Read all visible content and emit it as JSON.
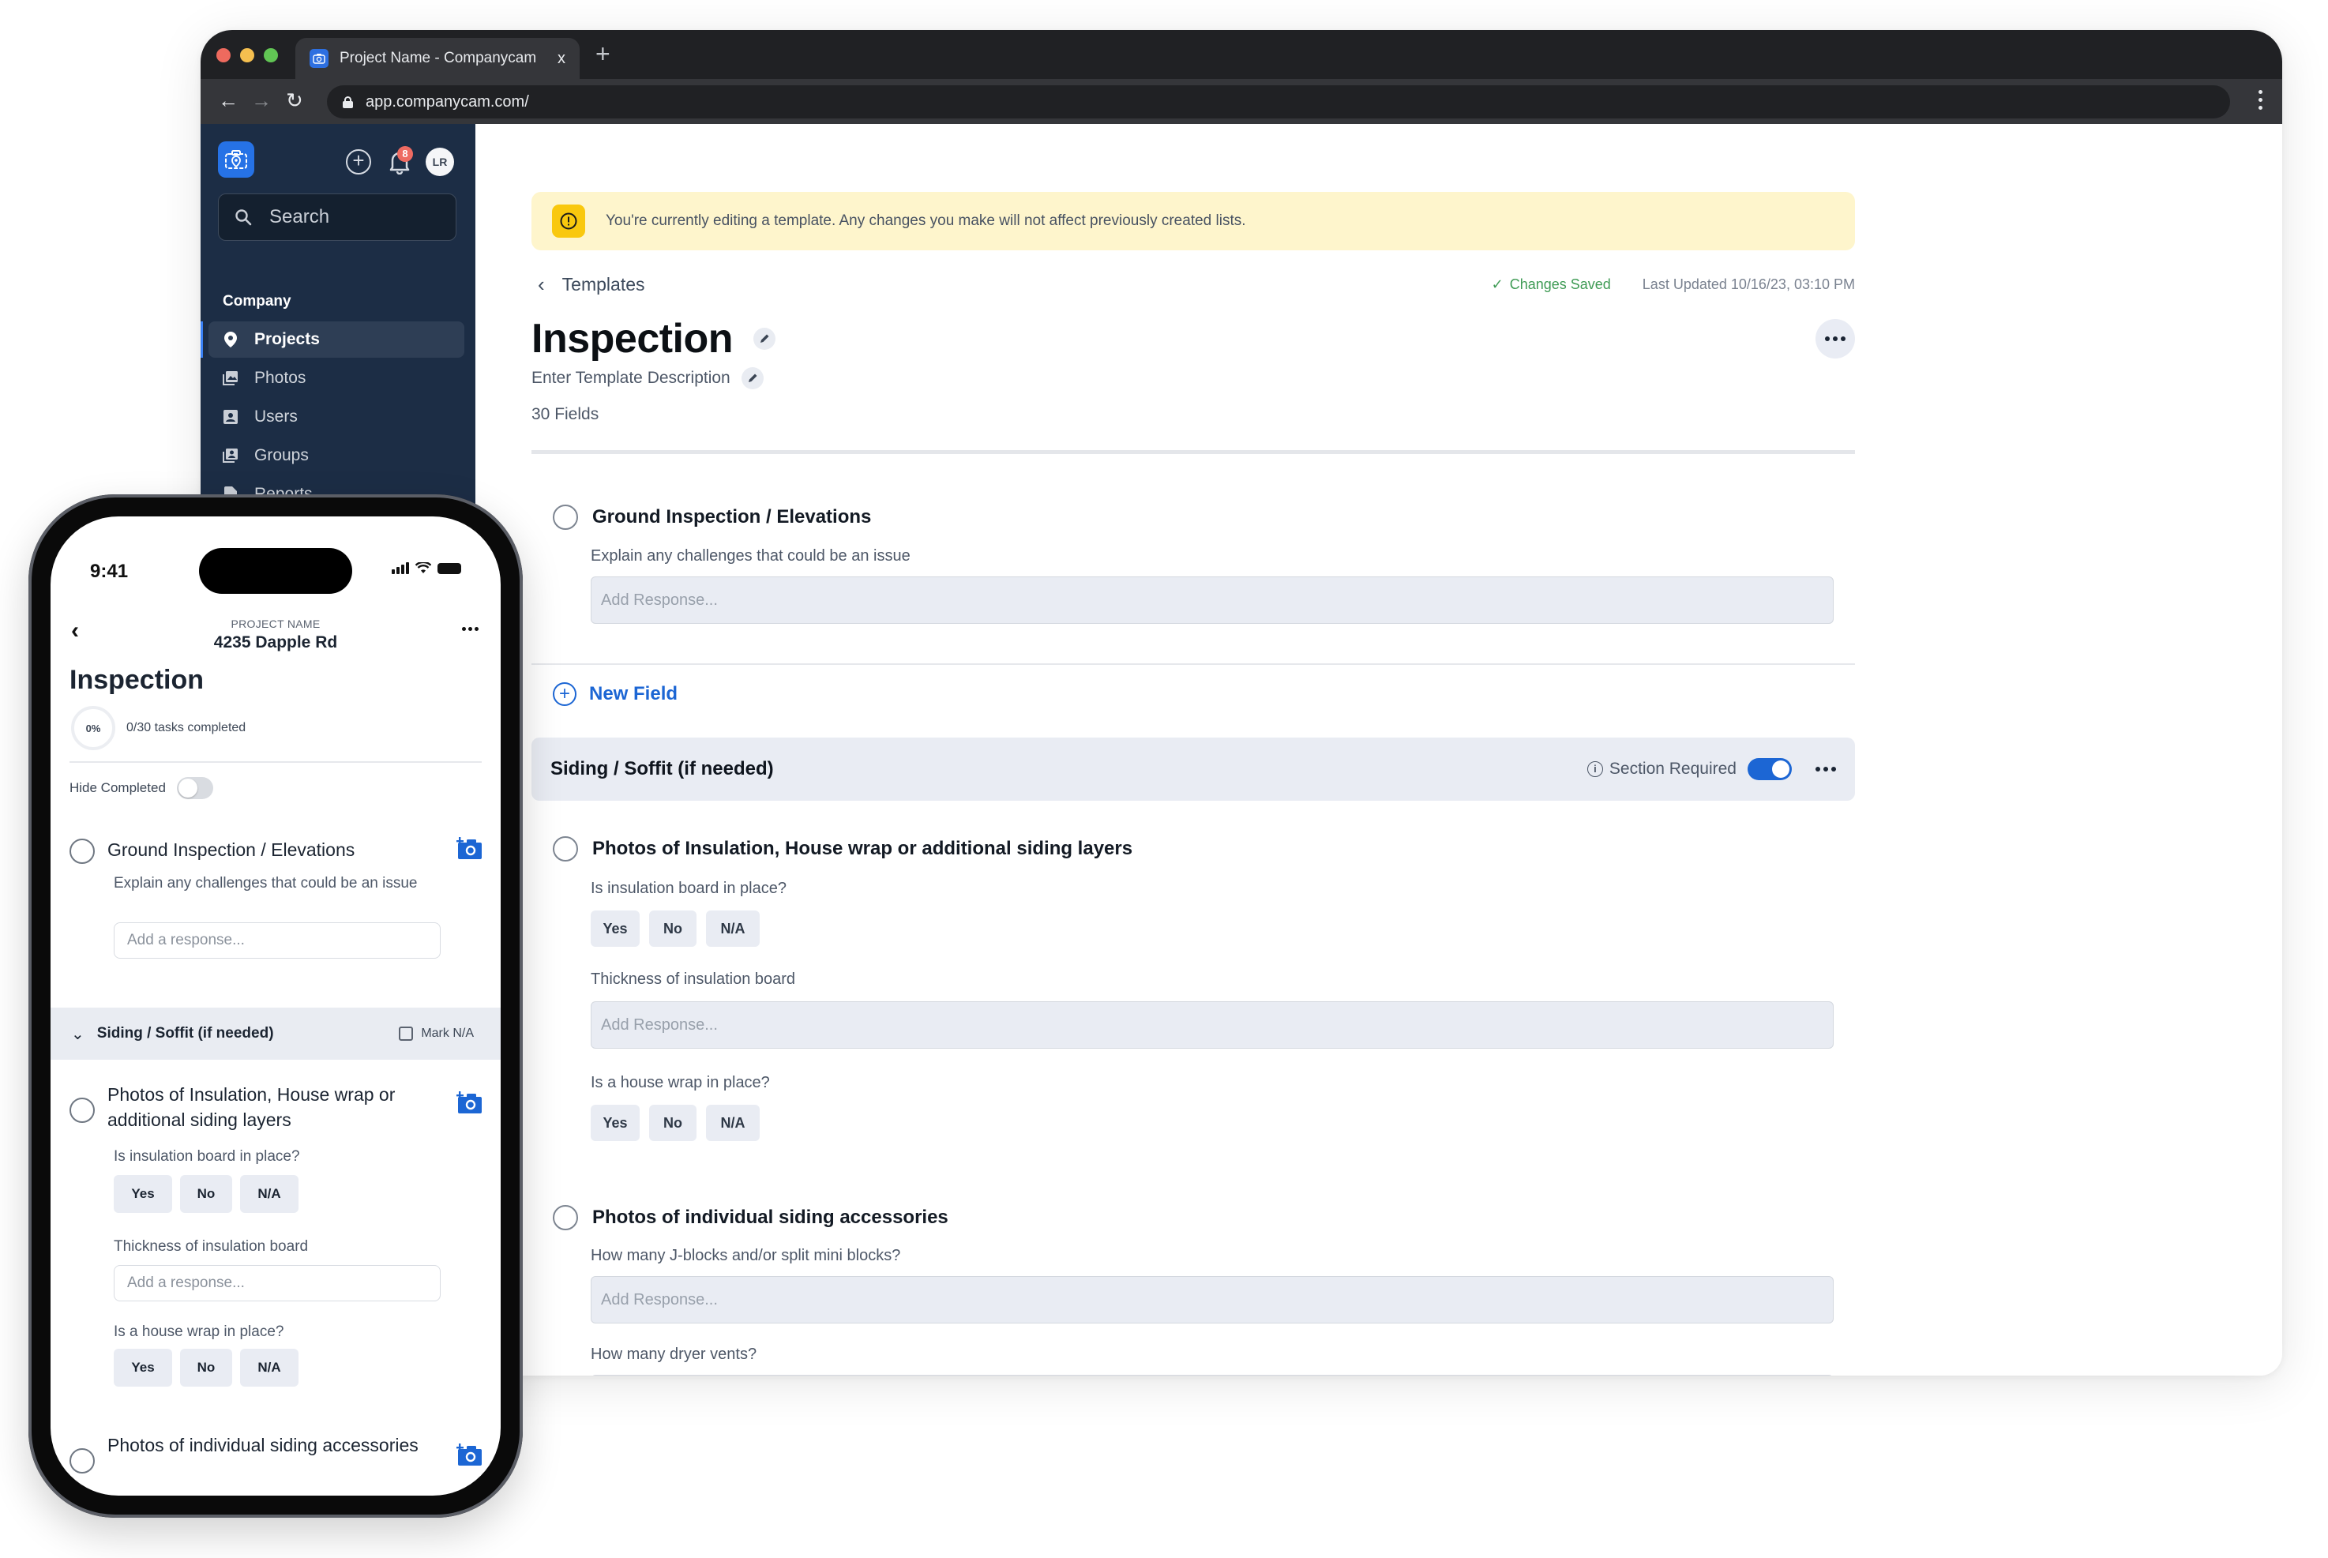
{
  "browser": {
    "tab_title": "Project Name - Companycam",
    "tab_close": "x",
    "new_tab": "+",
    "url": "app.companycam.com/",
    "back": "←",
    "forward": "→",
    "reload": "↻"
  },
  "sidebar": {
    "notification_count": "8",
    "avatar_initials": "LR",
    "search_placeholder": "Search",
    "section_label": "Company",
    "items": [
      {
        "label": "Projects",
        "icon": "map-pin-icon",
        "active": true
      },
      {
        "label": "Photos",
        "icon": "photos-icon",
        "active": false
      },
      {
        "label": "Users",
        "icon": "user-icon",
        "active": false
      },
      {
        "label": "Groups",
        "icon": "groups-icon",
        "active": false
      },
      {
        "label": "Reports",
        "icon": "report-icon",
        "active": false
      }
    ]
  },
  "main": {
    "banner_text": "You're currently editing a template. Any changes you make will not affect previously created lists.",
    "breadcrumb": "Templates",
    "changes_saved": "Changes Saved",
    "last_updated": "Last Updated 10/16/23, 03:10 PM",
    "title": "Inspection",
    "description_placeholder": "Enter Template Description",
    "field_count": "30 Fields",
    "new_field_label": "New Field",
    "response_placeholder": "Add Response...",
    "fields": [
      {
        "title": "Ground Inspection / Elevations",
        "sub": [
          {
            "label": "Explain any challenges that could be an issue",
            "type": "text"
          }
        ]
      },
      {
        "title": "Photos of Insulation, House wrap or additional siding layers",
        "sub": [
          {
            "label": "Is insulation board in place?",
            "type": "yna"
          },
          {
            "label": "Thickness of insulation board",
            "type": "text"
          },
          {
            "label": "Is a house wrap in place?",
            "type": "yna"
          }
        ]
      },
      {
        "title": "Photos of individual siding accessories",
        "sub": [
          {
            "label": "How many J-blocks and/or split mini blocks?",
            "type": "text"
          },
          {
            "label": "How many dryer vents?",
            "type": "text"
          }
        ]
      }
    ],
    "section": {
      "title": "Siding / Soffit (if needed)",
      "required_label": "Section Required",
      "required": true
    },
    "options": [
      "Yes",
      "No",
      "N/A"
    ]
  },
  "phone": {
    "time": "9:41",
    "project_label": "PROJECT NAME",
    "project_name": "4235 Dapple Rd",
    "title": "Inspection",
    "progress_percent": "0%",
    "progress_fraction": 0,
    "tasks_text": "0/30 tasks completed",
    "hide_completed_label": "Hide Completed",
    "hide_completed": false,
    "response_placeholder": "Add a response...",
    "section_title": "Siding / Soffit (if needed)",
    "mark_na_label": "Mark N/A",
    "fields": [
      {
        "title": "Ground Inspection / Elevations",
        "sub": "Explain any challenges that could be an issue"
      },
      {
        "title": "Photos of Insulation, House wrap or additional siding layers",
        "sub1": "Is insulation board in place?",
        "sub2": "Thickness of insulation board",
        "sub3": "Is a house wrap in place?"
      },
      {
        "title": "Photos of individual siding accessories",
        "sub": "How many J-blocks and/or split mini blocks?"
      }
    ]
  },
  "colors": {
    "brand_blue": "#2672e6",
    "link_blue": "#1c66d4",
    "sidebar_bg": "#1c2d45",
    "banner_bg": "#fef5cc",
    "warning_yellow": "#f9c80e",
    "saved_green": "#3f9b55",
    "badge_red": "#ee6b62"
  }
}
